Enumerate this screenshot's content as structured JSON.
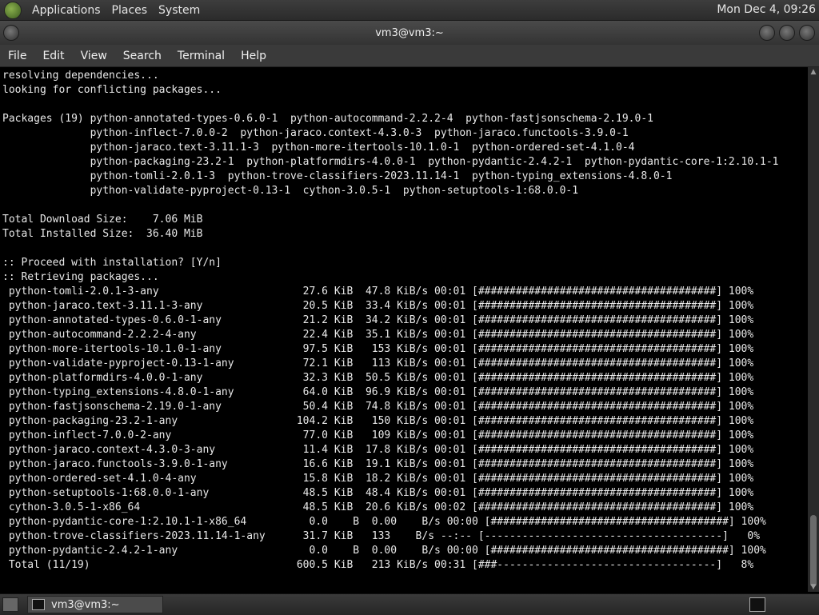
{
  "top_panel": {
    "menus": [
      "Applications",
      "Places",
      "System"
    ],
    "clock": "Mon Dec  4, 09:26"
  },
  "window": {
    "title": "vm3@vm3:~"
  },
  "menubar": [
    "File",
    "Edit",
    "View",
    "Search",
    "Terminal",
    "Help"
  ],
  "terminal": {
    "lines": [
      "resolving dependencies...",
      "looking for conflicting packages...",
      "",
      "Packages (19) python-annotated-types-0.6.0-1  python-autocommand-2.2.2-4  python-fastjsonschema-2.19.0-1",
      "              python-inflect-7.0.0-2  python-jaraco.context-4.3.0-3  python-jaraco.functools-3.9.0-1",
      "              python-jaraco.text-3.11.1-3  python-more-itertools-10.1.0-1  python-ordered-set-4.1.0-4",
      "              python-packaging-23.2-1  python-platformdirs-4.0.0-1  python-pydantic-2.4.2-1  python-pydantic-core-1:2.10.1-1",
      "              python-tomli-2.0.1-3  python-trove-classifiers-2023.11.14-1  python-typing_extensions-4.8.0-1",
      "              python-validate-pyproject-0.13-1  cython-3.0.5-1  python-setuptools-1:68.0.0-1",
      "",
      "Total Download Size:    7.06 MiB",
      "Total Installed Size:  36.40 MiB",
      "",
      ":: Proceed with installation? [Y/n]",
      ":: Retrieving packages...",
      " python-tomli-2.0.1-3-any                       27.6 KiB  47.8 KiB/s 00:01 [######################################] 100%",
      " python-jaraco.text-3.11.1-3-any                20.5 KiB  33.4 KiB/s 00:01 [######################################] 100%",
      " python-annotated-types-0.6.0-1-any             21.2 KiB  34.2 KiB/s 00:01 [######################################] 100%",
      " python-autocommand-2.2.2-4-any                 22.4 KiB  35.1 KiB/s 00:01 [######################################] 100%",
      " python-more-itertools-10.1.0-1-any             97.5 KiB   153 KiB/s 00:01 [######################################] 100%",
      " python-validate-pyproject-0.13-1-any           72.1 KiB   113 KiB/s 00:01 [######################################] 100%",
      " python-platformdirs-4.0.0-1-any                32.3 KiB  50.5 KiB/s 00:01 [######################################] 100%",
      " python-typing_extensions-4.8.0-1-any           64.0 KiB  96.9 KiB/s 00:01 [######################################] 100%",
      " python-fastjsonschema-2.19.0-1-any             50.4 KiB  74.8 KiB/s 00:01 [######################################] 100%",
      " python-packaging-23.2-1-any                   104.2 KiB   150 KiB/s 00:01 [######################################] 100%",
      " python-inflect-7.0.0-2-any                     77.0 KiB   109 KiB/s 00:01 [######################################] 100%",
      " python-jaraco.context-4.3.0-3-any              11.4 KiB  17.8 KiB/s 00:01 [######################################] 100%",
      " python-jaraco.functools-3.9.0-1-any            16.6 KiB  19.1 KiB/s 00:01 [######################################] 100%",
      " python-ordered-set-4.1.0-4-any                 15.8 KiB  18.2 KiB/s 00:01 [######################################] 100%",
      " python-setuptools-1:68.0.0-1-any               48.5 KiB  48.4 KiB/s 00:01 [######################################] 100%",
      " cython-3.0.5-1-x86_64                          48.5 KiB  20.6 KiB/s 00:02 [######################################] 100%",
      " python-pydantic-core-1:2.10.1-1-x86_64          0.0    B  0.00    B/s 00:00 [######################################] 100%",
      " python-trove-classifiers-2023.11.14-1-any      31.7 KiB   133    B/s --:-- [--------------------------------------]   0%",
      " python-pydantic-2.4.2-1-any                     0.0    B  0.00    B/s 00:00 [######################################] 100%",
      " Total (11/19)                                 600.5 KiB   213 KiB/s 00:31 [###-----------------------------------]   8%"
    ]
  },
  "taskbar": {
    "task_label": "vm3@vm3:~"
  }
}
